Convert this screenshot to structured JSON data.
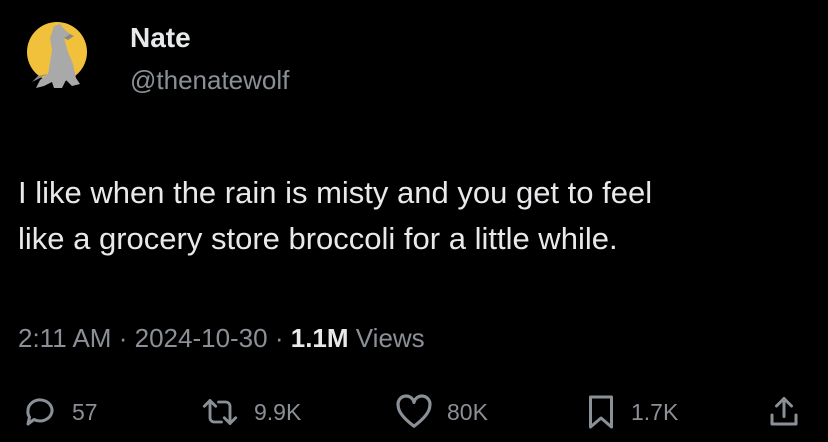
{
  "author": {
    "name": "Nate",
    "handle": "@thenatewolf",
    "avatar_icon": "howling-wolf-moon-avatar"
  },
  "tweet": {
    "text_lines": [
      "I like when the rain is misty and you get to feel",
      "like a grocery store broccoli for a little while."
    ]
  },
  "meta": {
    "time": "2:11 AM",
    "separator": "·",
    "date": "2024-10-30",
    "views_count": "1.1M",
    "views_label": "Views"
  },
  "actions": {
    "replies": "57",
    "reposts": "9.9K",
    "likes": "80K",
    "bookmarks": "1.7K"
  },
  "colors": {
    "background": "#000000",
    "primary_text": "#e7e9ea",
    "secondary_text": "#8b9096",
    "moon": "#f5c542"
  }
}
